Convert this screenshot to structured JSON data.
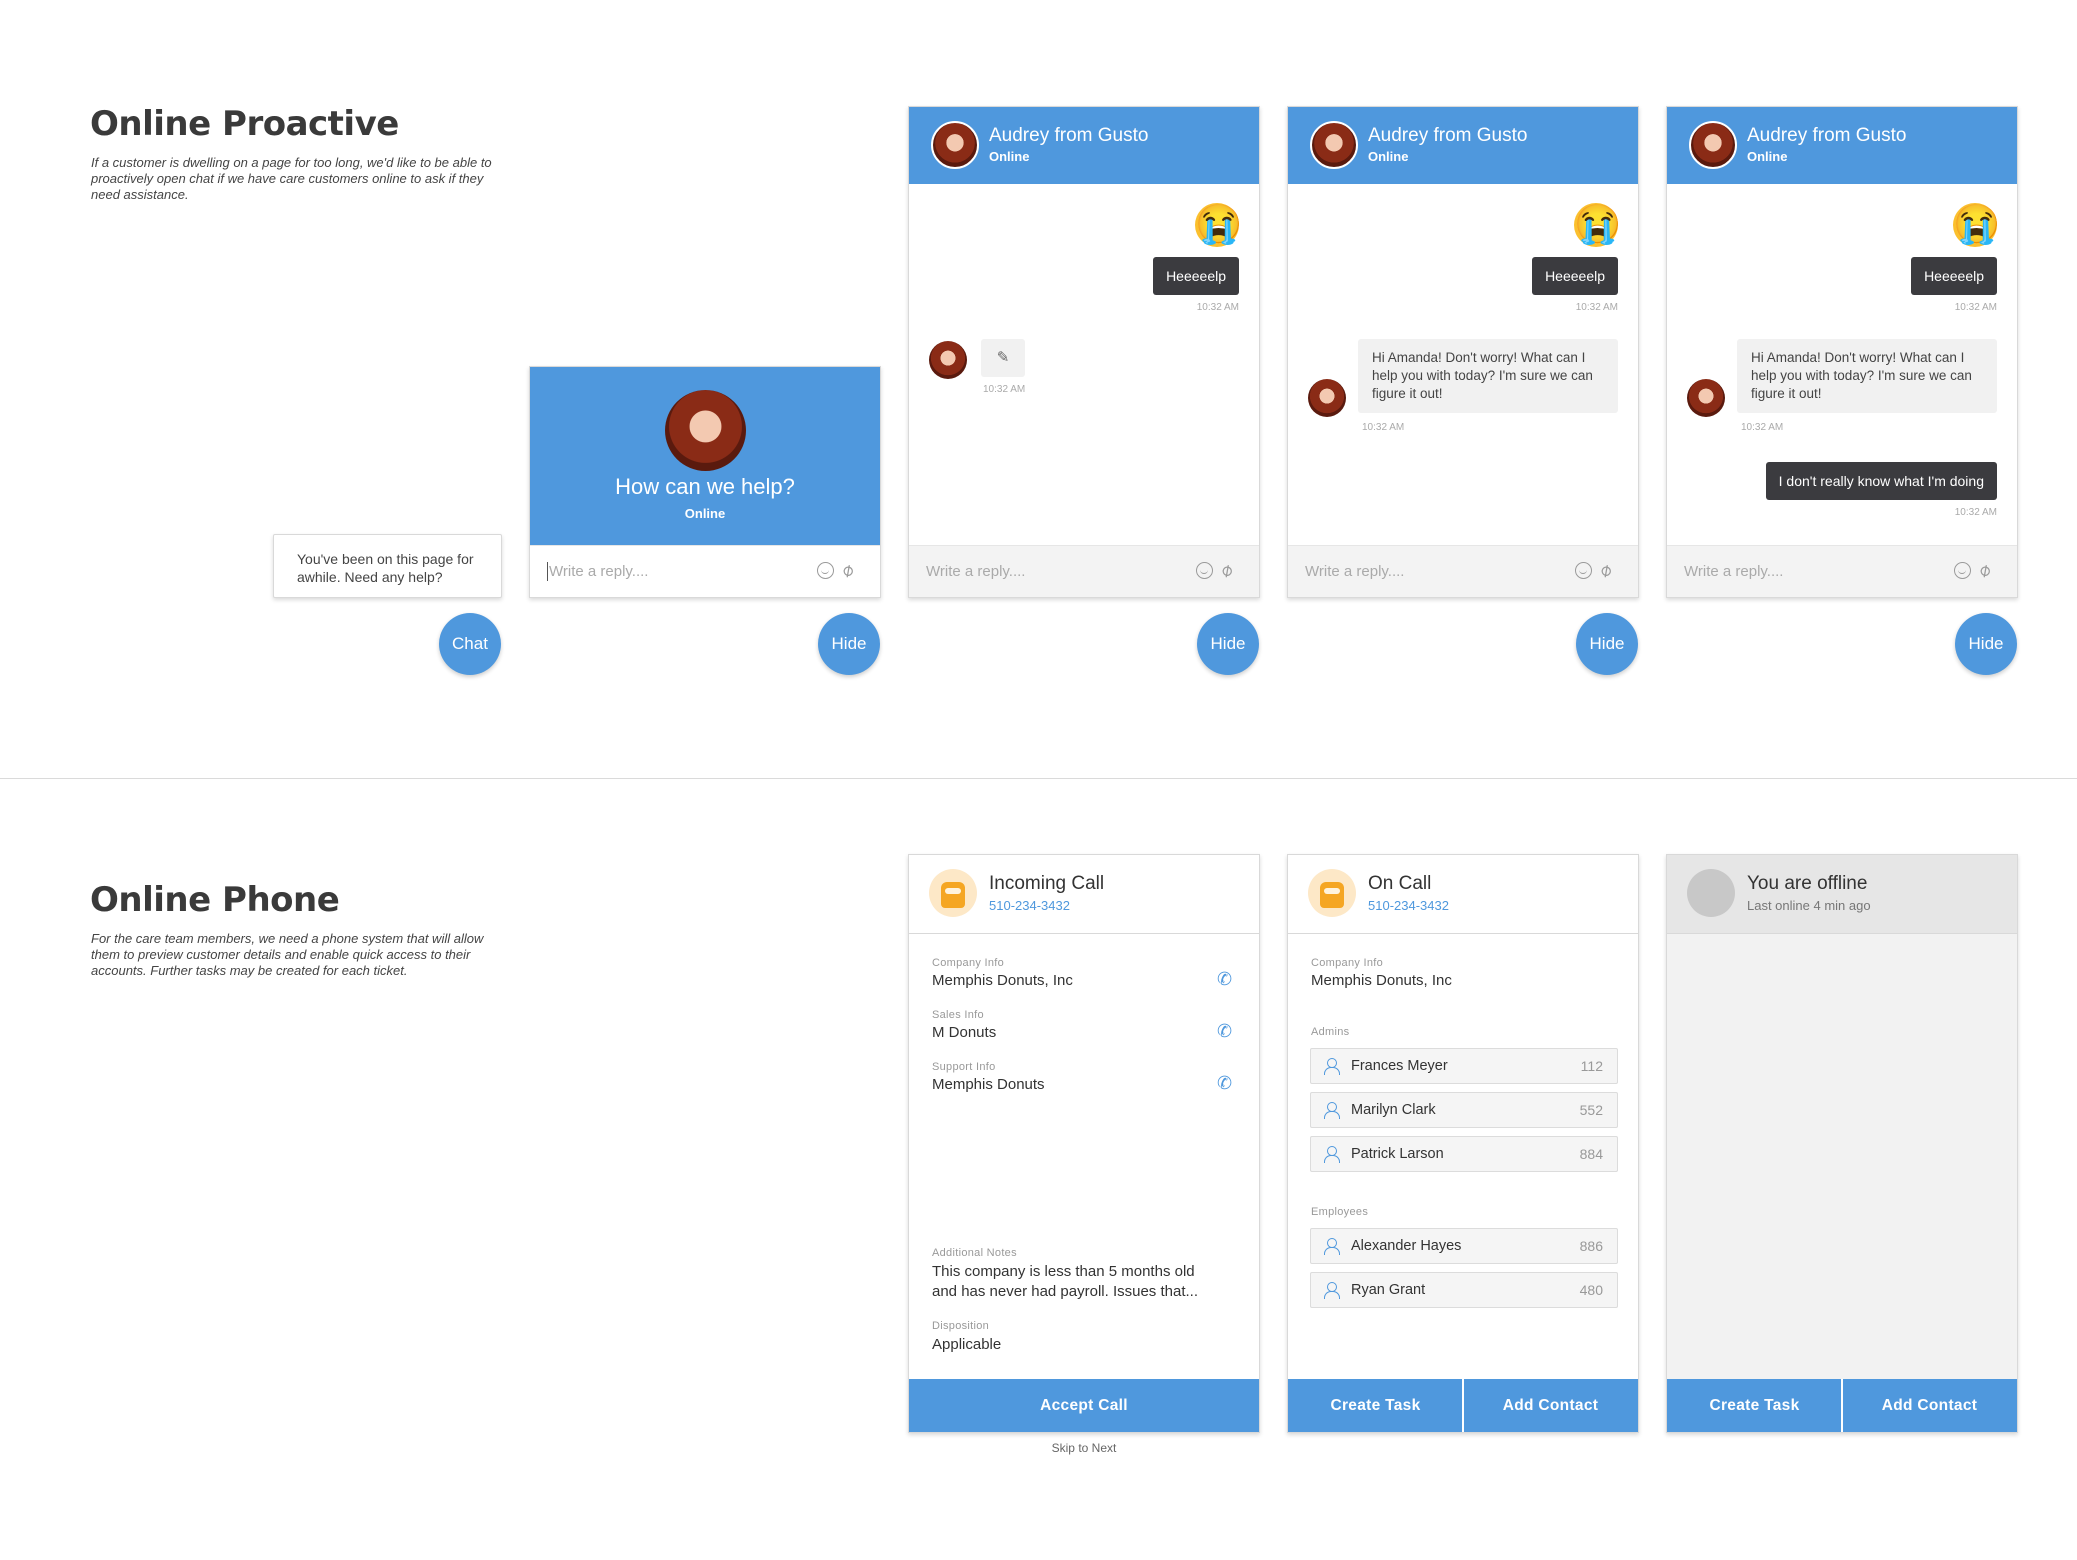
{
  "proactive": {
    "title": "Online Proactive",
    "description": "If a customer is dwelling on a page for too long,  we'd like to be able to proactively open chat if we have care customers online to ask if they need assistance.",
    "prompt_bubble": "You've been on this page for awhile. Need any help?",
    "chat_button": "Chat",
    "hide_button": "Hide",
    "help_card": {
      "title": "How can we help?",
      "status": "Online",
      "placeholder": "Write a reply...."
    },
    "agent": {
      "name": "Audrey from Gusto",
      "status": "Online"
    },
    "reply_placeholder": "Write a reply....",
    "messages": {
      "user_help": "Heeeeelp",
      "agent_reply": "Hi Amanda! Don't worry! What can I help you with today? I'm sure we can figure it out!",
      "user_followup": "I don't really know what I'm doing",
      "time": "10:32 AM"
    }
  },
  "phone": {
    "title": "Online Phone",
    "description": "For the care team members, we need a phone system that will allow them to preview customer details and enable quick access to their accounts. Further tasks may be created for each ticket.",
    "incoming": {
      "title": "Incoming Call",
      "number": "510-234-3432",
      "company_label": "Company Info",
      "company_value": "Memphis Donuts, Inc",
      "sales_label": "Sales Info",
      "sales_value": "M Donuts",
      "support_label": "Support Info",
      "support_value": "Memphis Donuts",
      "notes_label": "Additional Notes",
      "notes_value": "This company is less than 5 months old and has never had payroll. Issues that...",
      "disposition_label": "Disposition",
      "disposition_value": "Applicable",
      "accept": "Accept Call",
      "skip": "Skip to Next"
    },
    "oncall": {
      "title": "On Call",
      "number": "510-234-3432",
      "company_label": "Company Info",
      "company_value": "Memphis Donuts, Inc",
      "admins_label": "Admins",
      "admins": [
        {
          "name": "Frances Meyer",
          "ext": "112"
        },
        {
          "name": "Marilyn Clark",
          "ext": "552"
        },
        {
          "name": "Patrick Larson",
          "ext": "884"
        }
      ],
      "employees_label": "Employees",
      "employees": [
        {
          "name": "Alexander Hayes",
          "ext": "886"
        },
        {
          "name": "Ryan Grant",
          "ext": "480"
        }
      ],
      "create_task": "Create Task",
      "add_contact": "Add Contact"
    },
    "offline": {
      "title": "You are offline",
      "subtitle": "Last online 4 min ago",
      "create_task": "Create Task",
      "add_contact": "Add Contact"
    }
  },
  "colors": {
    "accent": "#4f98dd",
    "dark_bubble": "#3b3b3f",
    "offline_bg": "#f2f2f2"
  }
}
